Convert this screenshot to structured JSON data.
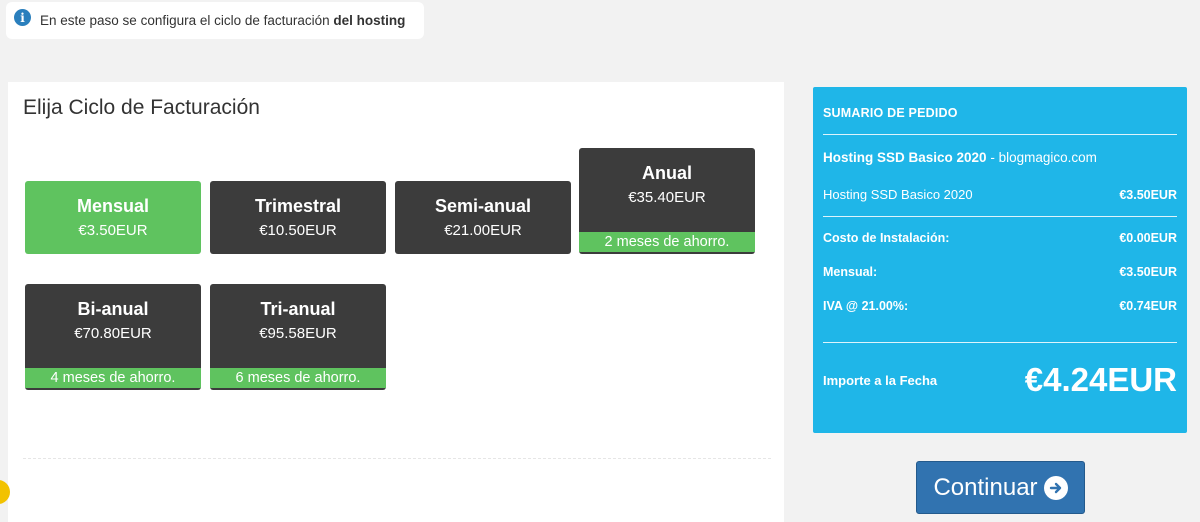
{
  "notice": {
    "text_before": "En este paso se configura el ciclo de facturación ",
    "text_bold": "del hosting"
  },
  "billing": {
    "title": "Elija Ciclo de Facturación",
    "cycles": [
      {
        "name": "Mensual",
        "price": "€3.50EUR",
        "savings": "",
        "selected": true
      },
      {
        "name": "Trimestral",
        "price": "€10.50EUR",
        "savings": "",
        "selected": false
      },
      {
        "name": "Semi-anual",
        "price": "€21.00EUR",
        "savings": "",
        "selected": false
      },
      {
        "name": "Anual",
        "price": "€35.40EUR",
        "savings": "2 meses de ahorro.",
        "selected": false
      },
      {
        "name": "Bi-anual",
        "price": "€70.80EUR",
        "savings": "4 meses de ahorro.",
        "selected": false
      },
      {
        "name": "Tri-anual",
        "price": "€95.58EUR",
        "savings": "6 meses de ahorro.",
        "selected": false
      }
    ]
  },
  "summary": {
    "title": "SUMARIO DE PEDIDO",
    "product_name": "Hosting SSD Basico 2020",
    "product_separator": " - ",
    "domain": "blogmagico.com",
    "item_label": "Hosting SSD Basico 2020",
    "item_price": "€3.50EUR",
    "setup_label": "Costo de Instalación:",
    "setup_value": "€0.00EUR",
    "cycle_label": "Mensual:",
    "cycle_value": "€3.50EUR",
    "tax_label": "IVA @ 21.00%:",
    "tax_value": "€0.74EUR",
    "total_label": "Importe a la Fecha",
    "total_value": "€4.24EUR"
  },
  "actions": {
    "continue_label": "Continuar"
  },
  "colors": {
    "accent_green": "#5fc35f",
    "summary_blue": "#1fb6e8",
    "button_blue": "#3173b0",
    "card_dark": "#3c3c3c"
  }
}
